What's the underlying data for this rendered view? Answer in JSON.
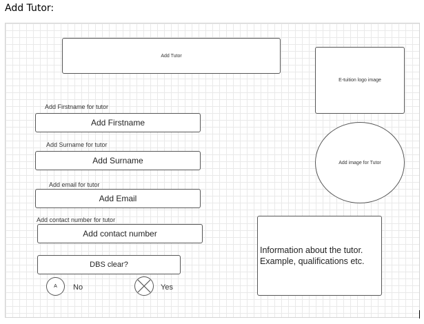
{
  "heading": "Add Tutor:",
  "title_box": "Add Tutor",
  "logo_box": "E-tuition logo image",
  "image_circle": "Add image for Tutor",
  "fields": [
    {
      "label": "Add Firstname for tutor",
      "placeholder": "Add Firstname"
    },
    {
      "label": "Add Surname for tutor",
      "placeholder": "Add Surname"
    },
    {
      "label": "Add email for tutor",
      "placeholder": "Add Email"
    },
    {
      "label": "Add contact number for tutor",
      "placeholder": "Add contact number"
    }
  ],
  "dbs": {
    "label": "DBS clear?",
    "no_option": {
      "symbol": "A",
      "label": "No"
    },
    "yes_option": {
      "symbol": "X",
      "label": "Yes"
    }
  },
  "info_box": {
    "line1": "Information about the tutor.",
    "line2": "Example, qualifications etc."
  }
}
